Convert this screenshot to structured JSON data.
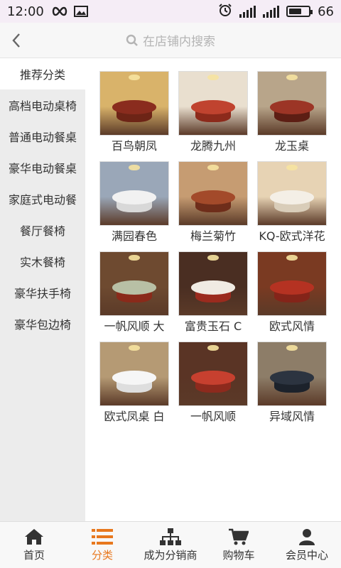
{
  "status_bar": {
    "time": "12:00",
    "battery_level": "66",
    "battery_fraction": 0.66,
    "icons": [
      "infinity-icon",
      "image-icon",
      "alarm-icon",
      "signal-icon",
      "4g-signal-icon",
      "battery-icon"
    ]
  },
  "header": {
    "search_placeholder": "在店铺内搜索"
  },
  "sidebar": {
    "items": [
      {
        "label": "推荐分类"
      },
      {
        "label": "高档电动桌椅"
      },
      {
        "label": "普通电动餐桌"
      },
      {
        "label": "豪华电动餐桌"
      },
      {
        "label": "家庭式电动餐"
      },
      {
        "label": "餐厅餐椅"
      },
      {
        "label": "实木餐椅"
      },
      {
        "label": "豪华扶手椅"
      },
      {
        "label": "豪华包边椅"
      }
    ]
  },
  "products": [
    {
      "title": "百鸟朝凤",
      "room": "#d9b36a",
      "top": "#8a2c1e",
      "base": "#6d2416"
    },
    {
      "title": "龙腾九州",
      "room": "#e9dfcf",
      "top": "#c0432f",
      "base": "#8c2a1b"
    },
    {
      "title": "龙玉桌",
      "room": "#b8a58a",
      "top": "#9c3526",
      "base": "#5d1e14"
    },
    {
      "title": "满园春色",
      "room": "#9aa7b8",
      "top": "#f1f1f1",
      "base": "#d8d8d8"
    },
    {
      "title": "梅兰菊竹",
      "room": "#c69c72",
      "top": "#a34a2a",
      "base": "#6e2d1a"
    },
    {
      "title": "KQ-欧式洋花",
      "room": "#e7d3b4",
      "top": "#f4efe6",
      "base": "#d9cdb9"
    },
    {
      "title": "一帆风顺 大",
      "room": "#6e4a30",
      "top": "#b8c0a5",
      "base": "#8a2a1a"
    },
    {
      "title": "富贵玉石 C",
      "room": "#4a2e22",
      "top": "#f0ebe3",
      "base": "#9b2b1e"
    },
    {
      "title": "欧式风情",
      "room": "#7a3a22",
      "top": "#b53222",
      "base": "#842419"
    },
    {
      "title": "欧式凤桌 白",
      "room": "#b59a74",
      "top": "#f6f6f6",
      "base": "#dedede"
    },
    {
      "title": "一帆风顺",
      "room": "#5a3425",
      "top": "#c7402f",
      "base": "#8d2a1d"
    },
    {
      "title": "异域风情",
      "room": "#8d7d68",
      "top": "#2c3440",
      "base": "#1c222b"
    }
  ],
  "bottom_nav": {
    "items": [
      {
        "label": "首页",
        "icon": "home-icon"
      },
      {
        "label": "分类",
        "icon": "list-icon"
      },
      {
        "label": "成为分销商",
        "icon": "sitemap-icon"
      },
      {
        "label": "购物车",
        "icon": "cart-icon"
      },
      {
        "label": "会员中心",
        "icon": "user-icon"
      }
    ]
  },
  "colors": {
    "accent": "#e8781e",
    "sidebar_bg": "#ececec",
    "active_bg": "#ffffff"
  }
}
